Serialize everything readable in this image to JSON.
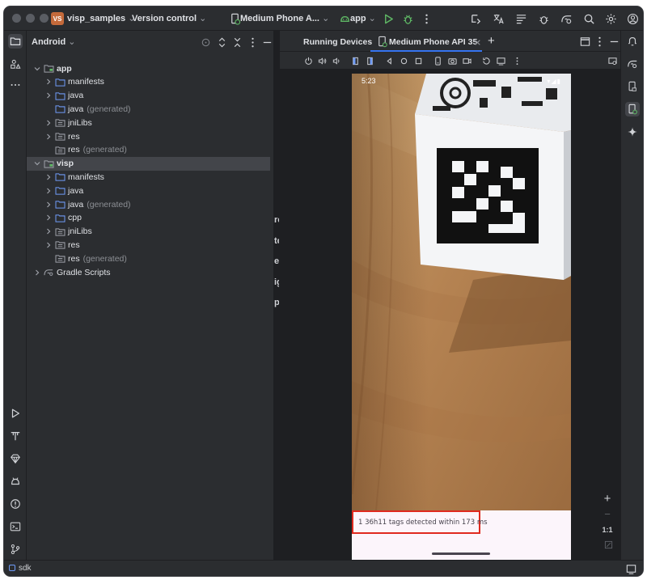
{
  "window": {
    "project_badge": "VS",
    "project_name": "visp_samples",
    "vcs_label": "Version control",
    "device_selector": "Medium Phone A...",
    "run_config": "app"
  },
  "project_panel": {
    "view_label": "Android",
    "tree": [
      {
        "label": "app",
        "note": "",
        "level": 0,
        "expanded": true,
        "bold": true,
        "kind": "module"
      },
      {
        "label": "manifests",
        "note": "",
        "level": 1,
        "expanded": false,
        "kind": "folder"
      },
      {
        "label": "java",
        "note": "",
        "level": 1,
        "expanded": false,
        "kind": "folder"
      },
      {
        "label": "java",
        "note": "(generated)",
        "level": 1,
        "leaf": true,
        "kind": "folder"
      },
      {
        "label": "jniLibs",
        "note": "",
        "level": 1,
        "expanded": false,
        "kind": "resfolder"
      },
      {
        "label": "res",
        "note": "",
        "level": 1,
        "expanded": false,
        "kind": "resfolder"
      },
      {
        "label": "res",
        "note": "(generated)",
        "level": 1,
        "leaf": true,
        "kind": "resfolder"
      },
      {
        "label": "visp",
        "note": "",
        "level": 0,
        "expanded": true,
        "bold": true,
        "selected": true,
        "kind": "module"
      },
      {
        "label": "manifests",
        "note": "",
        "level": 1,
        "expanded": false,
        "kind": "folder"
      },
      {
        "label": "java",
        "note": "",
        "level": 1,
        "expanded": false,
        "kind": "folder"
      },
      {
        "label": "java",
        "note": "(generated)",
        "level": 1,
        "expanded": false,
        "kind": "folder"
      },
      {
        "label": "cpp",
        "note": "",
        "level": 1,
        "expanded": false,
        "kind": "folder"
      },
      {
        "label": "jniLibs",
        "note": "",
        "level": 1,
        "expanded": false,
        "kind": "resfolder"
      },
      {
        "label": "res",
        "note": "",
        "level": 1,
        "expanded": false,
        "kind": "resfolder"
      },
      {
        "label": "res",
        "note": "(generated)",
        "level": 1,
        "leaf": true,
        "kind": "resfolder"
      },
      {
        "label": "Gradle Scripts",
        "note": "",
        "level": 0,
        "expanded": false,
        "kind": "gradle"
      }
    ]
  },
  "editor_hints": [
    "rch I",
    "to Fi",
    "ent I",
    "igat",
    "p file"
  ],
  "running_devices": {
    "panel_title": "Running Devices",
    "device_tab": "Medium Phone API 35",
    "add_tab": "+"
  },
  "phone": {
    "status_time": "5:23",
    "status_icons": "▾◢▮",
    "detection_text": "1 36h11 tags detected within 173 ms"
  },
  "zoom": {
    "plus": "+",
    "minus": "−",
    "actual_size": "1:1"
  },
  "status_bar": {
    "text": "sdk"
  },
  "colors": {
    "accent": "#3574f0",
    "highlight_box": "#e02a1f",
    "run_green": "#5fb865"
  }
}
